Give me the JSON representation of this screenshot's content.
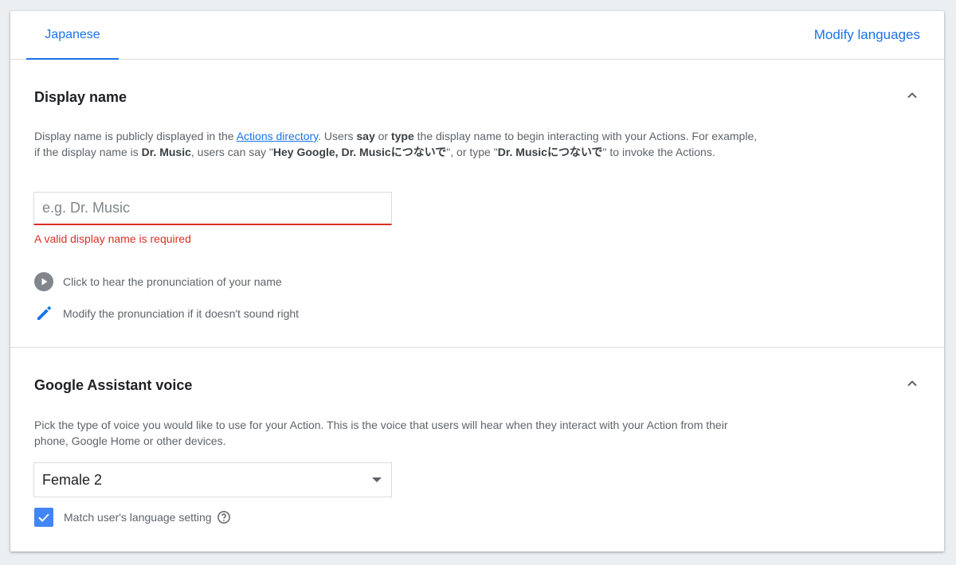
{
  "tabs": {
    "active_tab": "Japanese",
    "modify_languages": "Modify languages"
  },
  "display_name_section": {
    "title": "Display name",
    "desc_parts": {
      "p1": "Display name is publicly displayed in the ",
      "link": "Actions directory",
      "p2": ". Users ",
      "say": "say",
      "p3": " or ",
      "type": "type",
      "p4": " the display name to begin interacting with your Actions. For example, if the display name is ",
      "dr_music": "Dr. Music",
      "p5": ", users can say \"",
      "hey": "Hey Google, Dr. Musicにつないで",
      "p6": "\", or type \"",
      "typed": "Dr. Musicにつないで",
      "p7": "\" to invoke the Actions."
    },
    "input_placeholder": "e.g. Dr. Music",
    "input_value": "",
    "error": "A valid display name is required",
    "play_label": "Click to hear the pronunciation of your name",
    "edit_label": "Modify the pronunciation if it doesn't sound right"
  },
  "voice_section": {
    "title": "Google Assistant voice",
    "desc": "Pick the type of voice you would like to use for your Action. This is the voice that users will hear when they interact with your Action from their phone, Google Home or other devices.",
    "selected_voice": "Female 2",
    "checkbox_label": "Match user's language setting",
    "checkbox_checked": true
  },
  "colors": {
    "accent": "#1a73e8",
    "error": "#d93025",
    "checkbox": "#4285f4"
  },
  "icons": [
    "chevron-up-icon",
    "play-circle-icon",
    "pencil-icon",
    "check-icon",
    "help-circle-icon",
    "dropdown-arrow-icon"
  ]
}
